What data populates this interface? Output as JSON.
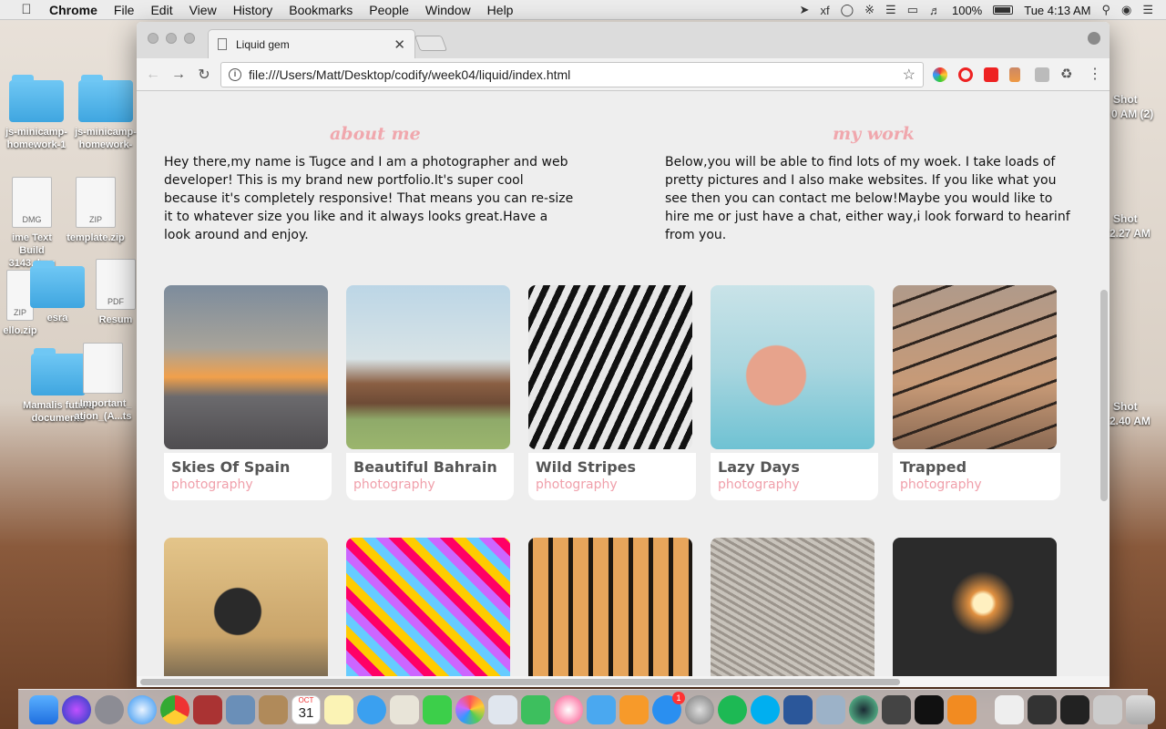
{
  "menubar": {
    "app_name": "Chrome",
    "menus": [
      "File",
      "Edit",
      "View",
      "History",
      "Bookmarks",
      "People",
      "Window",
      "Help"
    ],
    "battery": "100%",
    "clock": "Tue 4:13 AM"
  },
  "desktop": {
    "icons": [
      {
        "label": "js-minicamp-homework-1",
        "kind": "folder"
      },
      {
        "label": "js-minicamp-homework-",
        "kind": "folder"
      },
      {
        "label": "ime Text Build 3143.dmg",
        "kind": "dmg"
      },
      {
        "label": "template.zip",
        "kind": "zip"
      },
      {
        "label": "ello.zip",
        "kind": "zip"
      },
      {
        "label": "esra",
        "kind": "folder"
      },
      {
        "label": "Resum",
        "kind": "pdf"
      },
      {
        "label": "Mamalis future documents",
        "kind": "folder"
      },
      {
        "label": "_Important_ ation_(A...ts",
        "kind": "doc"
      }
    ],
    "screenshot_labels": [
      "Shot",
      "0 AM (2)",
      "Shot",
      "2.27 AM",
      "Shot",
      "2.40 AM"
    ]
  },
  "browser": {
    "tab_title": "Liquid gem",
    "url": "file:///Users/Matt/Desktop/codify/week04/liquid/index.html"
  },
  "page": {
    "about": {
      "heading": "about me",
      "text": "Hey there,my name is Tugce and I am a photographer and web developer! This is my brand new portfolio.It's super cool because it's completely responsive! That means you can re-size it to whatever size you like and it always looks great.Have a look around and enjoy."
    },
    "work": {
      "heading": "my work",
      "text": "Below,you will be able to find lots of my woek. I take loads of pretty pictures and I also make websites. If you like what you see then you can contact me below!Maybe you would like to hire me or just have a chat, either way,i look forward to hearinf from you."
    },
    "gallery": [
      {
        "title": "Skies Of Spain",
        "tag": "photography"
      },
      {
        "title": "Beautiful Bahrain",
        "tag": "photography"
      },
      {
        "title": "Wild Stripes",
        "tag": "photography"
      },
      {
        "title": "Lazy Days",
        "tag": "photography"
      },
      {
        "title": "Trapped",
        "tag": "photography"
      }
    ]
  },
  "dock": {
    "calendar_month": "OCT",
    "calendar_day": "31",
    "badge": "1"
  }
}
